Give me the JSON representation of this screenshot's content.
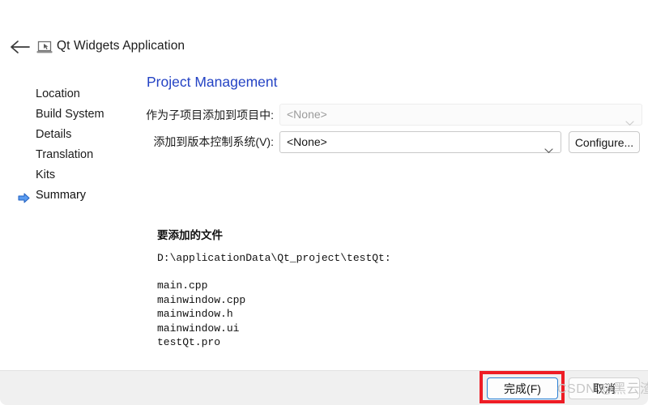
{
  "window": {
    "app_title": "Qt Widgets Application",
    "back_icon": "back-arrow-icon",
    "app_icon": "qt-widgets-app-icon"
  },
  "sidebar": {
    "items": [
      {
        "label": "Location",
        "current": false
      },
      {
        "label": "Build System",
        "current": false
      },
      {
        "label": "Details",
        "current": false
      },
      {
        "label": "Translation",
        "current": false
      },
      {
        "label": "Kits",
        "current": false
      },
      {
        "label": "Summary",
        "current": true
      }
    ],
    "current_marker_icon": "blue-right-arrow-icon"
  },
  "main": {
    "page_title": "Project Management",
    "fields": {
      "subproject": {
        "label": "作为子项目添加到项目中:",
        "value": "<None>",
        "disabled": true
      },
      "vcs": {
        "label": "添加到版本控制系统(V):",
        "value": "<None>",
        "disabled": false
      }
    },
    "configure_button": "Configure...",
    "chevron_icon": "chevron-down-icon"
  },
  "files": {
    "heading": "要添加的文件",
    "path": "D:\\applicationData\\Qt_project\\testQt:",
    "items": [
      "main.cpp",
      "mainwindow.cpp",
      "mainwindow.h",
      "mainwindow.ui",
      "testQt.pro"
    ]
  },
  "footer": {
    "finish_label": "完成(F)",
    "cancel_label": "取消"
  },
  "annotation": {
    "highlight_color": "#ee1c25"
  },
  "watermark": {
    "text": "CSDN @黑云渣"
  }
}
